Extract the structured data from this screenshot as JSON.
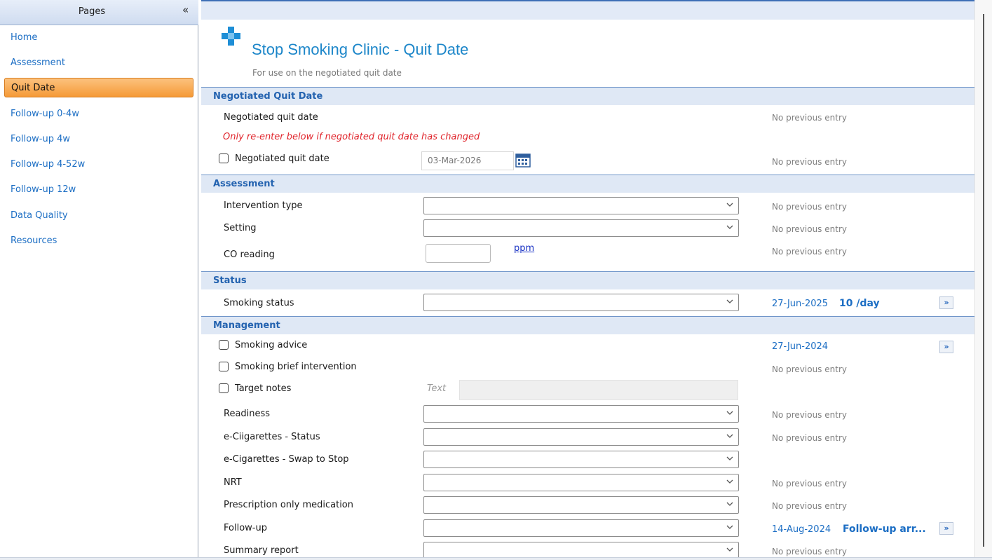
{
  "sidebar": {
    "title": "Pages",
    "collapse_glyph": "«",
    "items": [
      {
        "label": "Home"
      },
      {
        "label": "Assessment"
      },
      {
        "label": "Quit Date"
      },
      {
        "label": "Follow-up 0-4w"
      },
      {
        "label": "Follow-up 4w"
      },
      {
        "label": "Follow-up 4-52w"
      },
      {
        "label": "Follow-up 12w"
      },
      {
        "label": "Data Quality"
      },
      {
        "label": "Resources"
      }
    ],
    "active_index": 2
  },
  "header": {
    "logo_icon": "medical-cross-icon",
    "title": "Stop Smoking Clinic - Quit Date",
    "subtitle": "For use on the negotiated quit date"
  },
  "sections": {
    "negotiated": {
      "title": "Negotiated Quit Date",
      "label": "Negotiated quit date",
      "prev": "No previous entry",
      "warning": "Only re-enter below if negotiated quit date has changed",
      "checkbox_label": "Negotiated quit date",
      "date_value": "03-Mar-2026",
      "prev2": "No previous entry"
    },
    "assessment": {
      "title": "Assessment",
      "intervention_label": "Intervention type",
      "intervention_prev": "No previous entry",
      "setting_label": "Setting",
      "setting_prev": "No previous entry",
      "co_label": "CO reading",
      "co_unit": "ppm",
      "co_prev": "No previous entry"
    },
    "status": {
      "title": "Status",
      "smoking_label": "Smoking status",
      "prev_date": "27-Jun-2025",
      "prev_value": "10 /day"
    },
    "management": {
      "title": "Management",
      "advice_label": "Smoking advice",
      "advice_prev_date": "27-Jun-2024",
      "brief_label": "Smoking brief intervention",
      "brief_prev": "No previous entry",
      "target_label": "Target notes",
      "target_placeholder": "Text",
      "readiness_label": "Readiness",
      "readiness_prev": "No previous entry",
      "ecig_status_label": "e-Ciigarettes - Status",
      "ecig_status_prev": "No previous entry",
      "ecig_swap_label": "e-Cigarettes - Swap to Stop",
      "nrt_label": "NRT",
      "nrt_prev": "No previous entry",
      "prescription_label": "Prescription only medication",
      "prescription_prev": "No previous entry",
      "followup_label": "Follow-up",
      "followup_prev_date": "14-Aug-2024",
      "followup_prev_value": "Follow-up arr...",
      "summary_label": "Summary report",
      "summary_prev": "No previous entry"
    }
  },
  "more_glyph": "»",
  "colors": {
    "accent": "#1c86c9",
    "link": "#1c6ec4",
    "warning": "#e0252c",
    "active_nav": "#f59a37",
    "section_bg": "#dfe8f5"
  }
}
